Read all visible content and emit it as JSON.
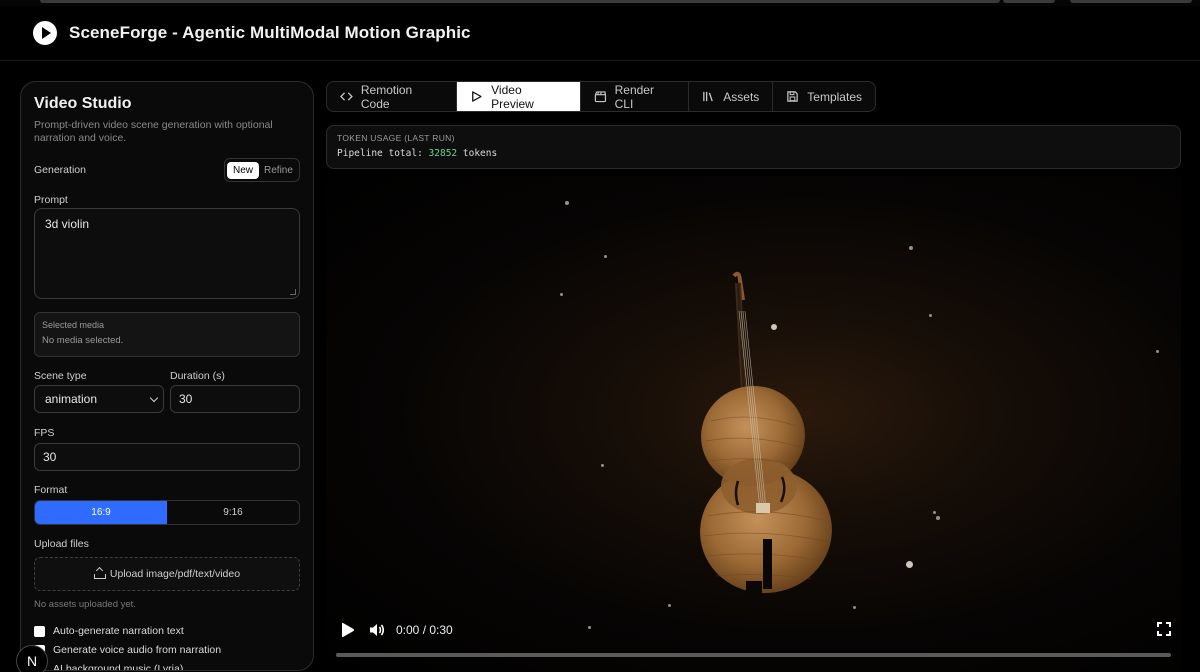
{
  "app": {
    "title": "SceneForge - Agentic MultiModal Motion Graphic"
  },
  "studio": {
    "title": "Video Studio",
    "subtitle": "Prompt-driven video scene generation with optional narration and voice.",
    "generation_label": "Generation",
    "mode_new": "New",
    "mode_refine": "Refine",
    "prompt_label": "Prompt",
    "prompt_value": "3d violin",
    "selected_media_label": "Selected media",
    "selected_media_value": "No media selected.",
    "scene_type_label": "Scene type",
    "scene_type_value": "animation",
    "duration_label": "Duration (s)",
    "duration_value": "30",
    "fps_label": "FPS",
    "fps_value": "30",
    "format_label": "Format",
    "format_options": [
      "16:9",
      "9:16"
    ],
    "format_selected": "16:9",
    "upload_label": "Upload files",
    "upload_button": "Upload image/pdf/text/video",
    "assets_status": "No assets uploaded yet.",
    "checkboxes": [
      "Auto-generate narration text",
      "Generate voice audio from narration",
      "AI background music (Lyria)"
    ]
  },
  "tabs": [
    {
      "label": "Remotion Code",
      "icon": "code-icon"
    },
    {
      "label": "Video Preview",
      "icon": "play-icon",
      "active": true
    },
    {
      "label": "Render CLI",
      "icon": "clapperboard-icon"
    },
    {
      "label": "Assets",
      "icon": "library-icon"
    },
    {
      "label": "Templates",
      "icon": "save-icon"
    }
  ],
  "tokens": {
    "heading": "TOKEN USAGE (LAST RUN)",
    "prefix": "Pipeline total:",
    "count": "32852",
    "suffix": "tokens"
  },
  "player": {
    "time": "0:00 / 0:30",
    "progress": 0.0
  },
  "badge": {
    "letter": "N"
  },
  "colors": {
    "accent": "#2f6bff",
    "token_number": "#6fd48a"
  }
}
